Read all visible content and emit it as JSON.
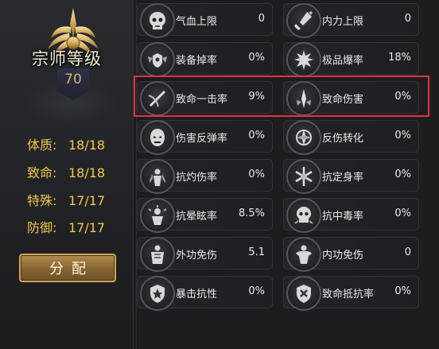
{
  "character": {
    "rank_title": "宗师等级",
    "level": "70"
  },
  "attributes": [
    {
      "name": "体质:",
      "value": "18/18"
    },
    {
      "name": "致命:",
      "value": "18/18"
    },
    {
      "name": "特殊:",
      "value": "17/17"
    },
    {
      "name": "防御:",
      "value": "17/17"
    }
  ],
  "allocate_button": "分配",
  "stats": [
    {
      "label": "气血上限",
      "value": "0",
      "icon": "skull-mask-icon"
    },
    {
      "label": "内力上限",
      "value": "0",
      "icon": "fist-power-icon"
    },
    {
      "label": "装备掉率",
      "value": "0%",
      "icon": "winged-shield-icon"
    },
    {
      "label": "极品爆率",
      "value": "18%",
      "icon": "burst-explosion-icon"
    },
    {
      "label": "致命一击率",
      "value": "9%",
      "icon": "slash-strike-icon"
    },
    {
      "label": "致命伤害",
      "value": "0%",
      "icon": "blade-impact-icon"
    },
    {
      "label": "伤害反弹率",
      "value": "0%",
      "icon": "demon-mask-icon"
    },
    {
      "label": "反伤转化",
      "value": "0%",
      "icon": "rune-orb-icon"
    },
    {
      "label": "抗灼伤率",
      "value": "0%",
      "icon": "burning-figure-icon"
    },
    {
      "label": "抗定身率",
      "value": "0%",
      "icon": "ice-crystal-icon"
    },
    {
      "label": "抗晕眩率",
      "value": "8.5%",
      "icon": "stunned-figure-icon"
    },
    {
      "label": "抗中毒率",
      "value": "0%",
      "icon": "poison-skull-icon"
    },
    {
      "label": "外功免伤",
      "value": "5.1",
      "icon": "armored-body-icon"
    },
    {
      "label": "内功免伤",
      "value": "0",
      "icon": "muscle-body-icon"
    },
    {
      "label": "暴击抗性",
      "value": "0%",
      "icon": "crest-shield-icon"
    },
    {
      "label": "致命抵抗率",
      "value": "0%",
      "icon": "guard-shield-icon"
    }
  ],
  "colors": {
    "attribute_text": "#f0c84a",
    "highlight_border": "#e0343a",
    "button_gold": "#b18c4e",
    "level_text": "#d7b472"
  }
}
